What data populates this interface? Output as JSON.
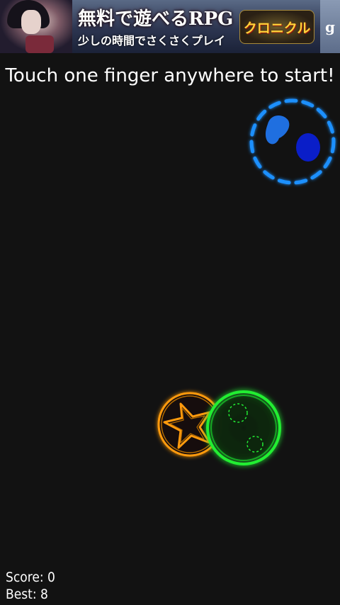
{
  "ad": {
    "headline": "無料で遊べるRPG",
    "subline": "少しの時間でさくさくプレイ",
    "logo_text": "クロニクル",
    "side_label": "g"
  },
  "instruction": "Touch one finger anywhere to start!",
  "hud": {
    "score_label": "Score: 0",
    "best_label": "Best: 8"
  },
  "colors": {
    "background": "#121212",
    "blue_ring": "#1e90ff",
    "blue_blob": "#1f6fe0",
    "blue_dot": "#0a1ec8",
    "orange": "#ff9a10",
    "green": "#22ee33"
  },
  "game_objects": [
    {
      "name": "blue-dashed-target-ring",
      "shape": "dashed circle"
    },
    {
      "name": "blue-blob",
      "shape": "blob"
    },
    {
      "name": "dark-blue-dot",
      "shape": "oval"
    },
    {
      "name": "orange-star-ring",
      "shape": "ring with star"
    },
    {
      "name": "green-glow-ring",
      "shape": "ring with two dotted circles"
    }
  ]
}
